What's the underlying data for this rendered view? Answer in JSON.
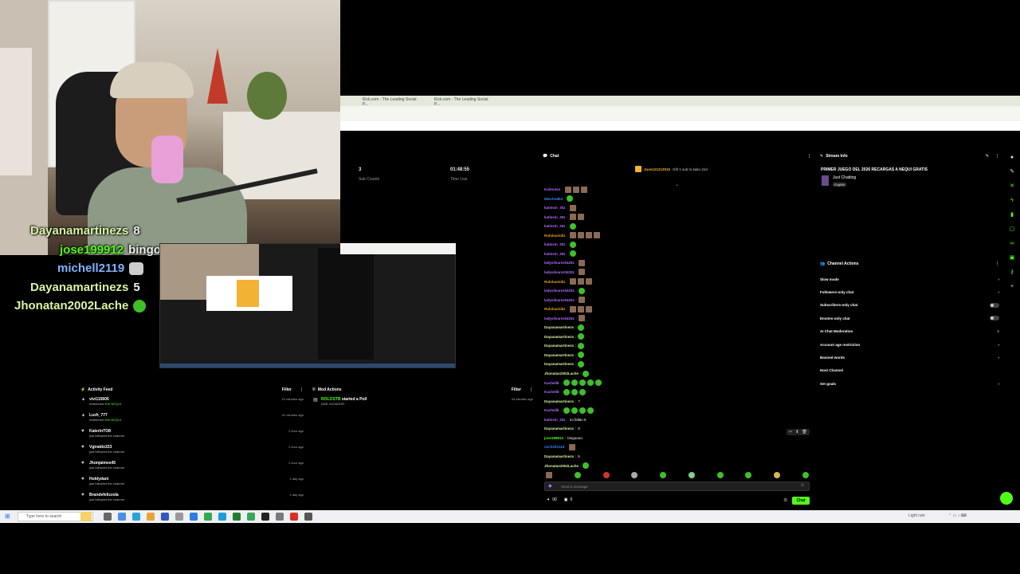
{
  "overlay_chat": [
    {
      "user": "Dayanamartinezs",
      "msg": "8",
      "color": "#d9f5a4"
    },
    {
      "user": "jose199912",
      "msg": "bingoooo",
      "color": "#53fc18"
    },
    {
      "user": "michell2119",
      "msg": "",
      "color": "#7fb3ff"
    },
    {
      "user": "Dayanamartinezs",
      "msg": "5",
      "color": "#d9f5a4"
    },
    {
      "user": "Jhonatan2002Lache",
      "msg": "",
      "color": "#d9f5a4"
    }
  ],
  "browser": {
    "tabs": [
      "Kick.com - The Leading Social P...",
      "Kick.com - The Leading Social P..."
    ]
  },
  "stats": {
    "sub_value": "3",
    "sub_label": "Sub Counts",
    "time_value": "01:48:55",
    "time_label": "Time Live"
  },
  "activity": {
    "title": "Activity Feed",
    "filter": "Filter",
    "items": [
      {
        "name": "vivi115606",
        "desc": "redeemed",
        "hl": "30K NEQUI",
        "time": "21 minutes ago"
      },
      {
        "name": "Luzh_777",
        "desc": "redeemed",
        "hl": "30K NEQUI",
        "time": "41 minutes ago"
      },
      {
        "name": "KaterinTO8",
        "desc": "just followed the channel",
        "hl": "",
        "time": "1 hour ago"
      },
      {
        "name": "Vgiraldo333",
        "desc": "just followed the channel",
        "hl": "",
        "time": "1 hour ago"
      },
      {
        "name": "Jhonjaimes45",
        "desc": "just followed the channel",
        "hl": "",
        "time": "1 hour ago"
      },
      {
        "name": "Holdydani",
        "desc": "just followed the channel",
        "hl": "",
        "time": "1 day ago"
      },
      {
        "name": "Brandefelizzola",
        "desc": "just followed the channel",
        "hl": "",
        "time": "1 day ago"
      }
    ]
  },
  "mod_actions": {
    "title": "Mod Actions",
    "filter": "Filter",
    "item_user": "ROLOSTB",
    "item_action": "started a Poll",
    "item_sub": "DAR JUGADOR",
    "item_time": "44 minutes ago"
  },
  "chat": {
    "title": "Chat",
    "pinned_user": "Juan121213015",
    "pinned_text": "Gift 1 sub to kaito 2nd",
    "input_placeholder": "Send a message",
    "points": "00",
    "gifts": "0",
    "send_label": "Chat",
    "lines": [
      {
        "user": "Kaiteutoz",
        "color": "#b36bff",
        "msg": "",
        "emotes": 3,
        "pic": true
      },
      {
        "user": "Miecho853",
        "color": "#3b82f6",
        "msg": "",
        "emotes": 1,
        "pic": false
      },
      {
        "user": "katiesin_30z",
        "color": "#b36bff",
        "msg": "",
        "emotes": 1,
        "pic": true
      },
      {
        "user": "katiesin_30z",
        "color": "#b36bff",
        "msg": "",
        "emotes": 2,
        "pic": true
      },
      {
        "user": "katiesin_30z",
        "color": "#b36bff",
        "msg": "",
        "emotes": 1,
        "pic": false
      },
      {
        "user": "Rulolauinikz",
        "color": "#f0a020",
        "msg": "",
        "emotes": 4,
        "pic": true
      },
      {
        "user": "katiesin_30z",
        "color": "#b36bff",
        "msg": "",
        "emotes": 1,
        "pic": false
      },
      {
        "user": "katiesin_30z",
        "color": "#b36bff",
        "msg": "",
        "emotes": 1,
        "pic": false
      },
      {
        "user": "ladysilvarez0420z",
        "color": "#b36bff",
        "msg": "",
        "emotes": 1,
        "pic": true
      },
      {
        "user": "ladysilvarez0420z",
        "color": "#b36bff",
        "msg": "",
        "emotes": 1,
        "pic": true
      },
      {
        "user": "Rulolauinikz",
        "color": "#f0a020",
        "msg": "",
        "emotes": 3,
        "pic": true
      },
      {
        "user": "ladysilvarez0420z",
        "color": "#b36bff",
        "msg": "",
        "emotes": 1,
        "pic": false
      },
      {
        "user": "ladysilvarez0420z",
        "color": "#b36bff",
        "msg": "",
        "emotes": 1,
        "pic": true
      },
      {
        "user": "Rulolauinikz",
        "color": "#f0a020",
        "msg": "",
        "emotes": 3,
        "pic": true
      },
      {
        "user": "ladysilvarez0420z",
        "color": "#b36bff",
        "msg": "",
        "emotes": 1,
        "pic": true
      },
      {
        "user": "Dayanamartinezs",
        "color": "#d9f5a4",
        "msg": "",
        "emotes": 1,
        "pic": false
      },
      {
        "user": "Dayanamartinezs",
        "color": "#d9f5a4",
        "msg": "",
        "emotes": 1,
        "pic": false
      },
      {
        "user": "Dayanamartinezs",
        "color": "#d9f5a4",
        "msg": "",
        "emotes": 1,
        "pic": false
      },
      {
        "user": "Dayanamartinezs",
        "color": "#d9f5a4",
        "msg": "",
        "emotes": 1,
        "pic": false
      },
      {
        "user": "Dayanamartinezs",
        "color": "#d9f5a4",
        "msg": "",
        "emotes": 1,
        "pic": false
      },
      {
        "user": "Jhonatan2002Lache",
        "color": "#d9f5a4",
        "msg": "",
        "emotes": 1,
        "pic": false
      },
      {
        "user": "Kachelik",
        "color": "#b36bff",
        "msg": "",
        "emotes": 5,
        "pic": false
      },
      {
        "user": "Kachelik",
        "color": "#b36bff",
        "msg": "",
        "emotes": 3,
        "pic": false
      },
      {
        "user": "Dayanamartinezs",
        "color": "#d9f5a4",
        "msg": "7",
        "emotes": 0,
        "pic": false
      },
      {
        "user": "Kachelik",
        "color": "#b36bff",
        "msg": "",
        "emotes": 4,
        "pic": false
      },
      {
        "user": "katiesin_30z",
        "color": "#b36bff",
        "msg": "no fallan 6",
        "emotes": 0,
        "pic": false
      },
      {
        "user": "Dayanamartinezs",
        "color": "#d9f5a4",
        "msg": "8",
        "emotes": 0,
        "pic": false
      },
      {
        "user": "jose199912",
        "color": "#53fc18",
        "msg": "bingoooo",
        "emotes": 0,
        "pic": false
      },
      {
        "user": "michell2119",
        "color": "#3b82f6",
        "msg": "",
        "emotes": 1,
        "pic": true
      },
      {
        "user": "Dayanamartinezs",
        "color": "#d9f5a4",
        "msg": "5",
        "emotes": 0,
        "pic": false
      },
      {
        "user": "Jhonatan2002Lache",
        "color": "#d9f5a4",
        "msg": "",
        "emotes": 1,
        "pic": false
      }
    ]
  },
  "stream_info": {
    "title": "Stream Info",
    "stream_title": "PRIMER JUEGO DEL 2026 RECARGAS A NEQUI GRATIS",
    "category": "Just Chatting",
    "language": "English"
  },
  "channel_actions": {
    "title": "Channel Actions",
    "rows": [
      {
        "label": "Slow mode",
        "control": "chevron"
      },
      {
        "label": "Followers-only chat",
        "control": "chevron"
      },
      {
        "label": "Subscribers-only chat",
        "control": "toggle"
      },
      {
        "label": "Emotes-only chat",
        "control": "toggle"
      },
      {
        "label": "AI Chat Moderation",
        "control": "settings"
      },
      {
        "label": "Account age restriction",
        "control": "chevron"
      },
      {
        "label": "Banned words",
        "control": "chevron"
      },
      {
        "label": "Host Channel",
        "control": "none"
      },
      {
        "label": "Set goals",
        "control": "chevron"
      }
    ]
  },
  "taskbar": {
    "search_placeholder": "Type here to search",
    "weather": "Light rain"
  },
  "colors": {
    "accent": "#53fc18",
    "panel_bg": "#0b0b0b"
  }
}
